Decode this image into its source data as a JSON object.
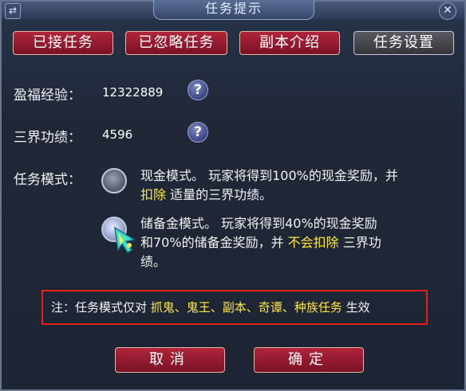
{
  "window": {
    "title": "任务提示"
  },
  "tabs": [
    {
      "label": "已接任务",
      "active": false
    },
    {
      "label": "已忽略任务",
      "active": false
    },
    {
      "label": "副本介绍",
      "active": false
    },
    {
      "label": "任务设置",
      "active": true
    }
  ],
  "stats": {
    "exp_label": "盈福经验：",
    "exp_value": "12322889",
    "merit_label": "三界功绩：",
    "merit_value": "4596"
  },
  "mode": {
    "label": "任务模式：",
    "options": [
      {
        "checked": false,
        "line1_a": "现金模式。 玩家将得到100%的现金奖励，并",
        "line2_hl": "扣除",
        "line2_b": " 适量的三界功绩。"
      },
      {
        "checked": true,
        "line1": "储备金模式。 玩家将得到40%的现金奖励",
        "line2_a": "和70%的储备金奖励，并 ",
        "line2_hl": "不会扣除",
        "line2_b": " 三界功",
        "line3": "绩。"
      }
    ]
  },
  "note": {
    "prefix": "注：任务模式仅对 ",
    "highlight": "抓鬼、鬼王、副本、奇谭、种族任务",
    "suffix": " 生效"
  },
  "buttons": {
    "cancel": "取消",
    "confirm": "确定"
  },
  "icons": {
    "help": "?",
    "swap": "⇄",
    "close": "✕"
  },
  "colors": {
    "highlight": "#ffe83a",
    "note_border": "#e0221b",
    "button": "#9a1c30"
  }
}
